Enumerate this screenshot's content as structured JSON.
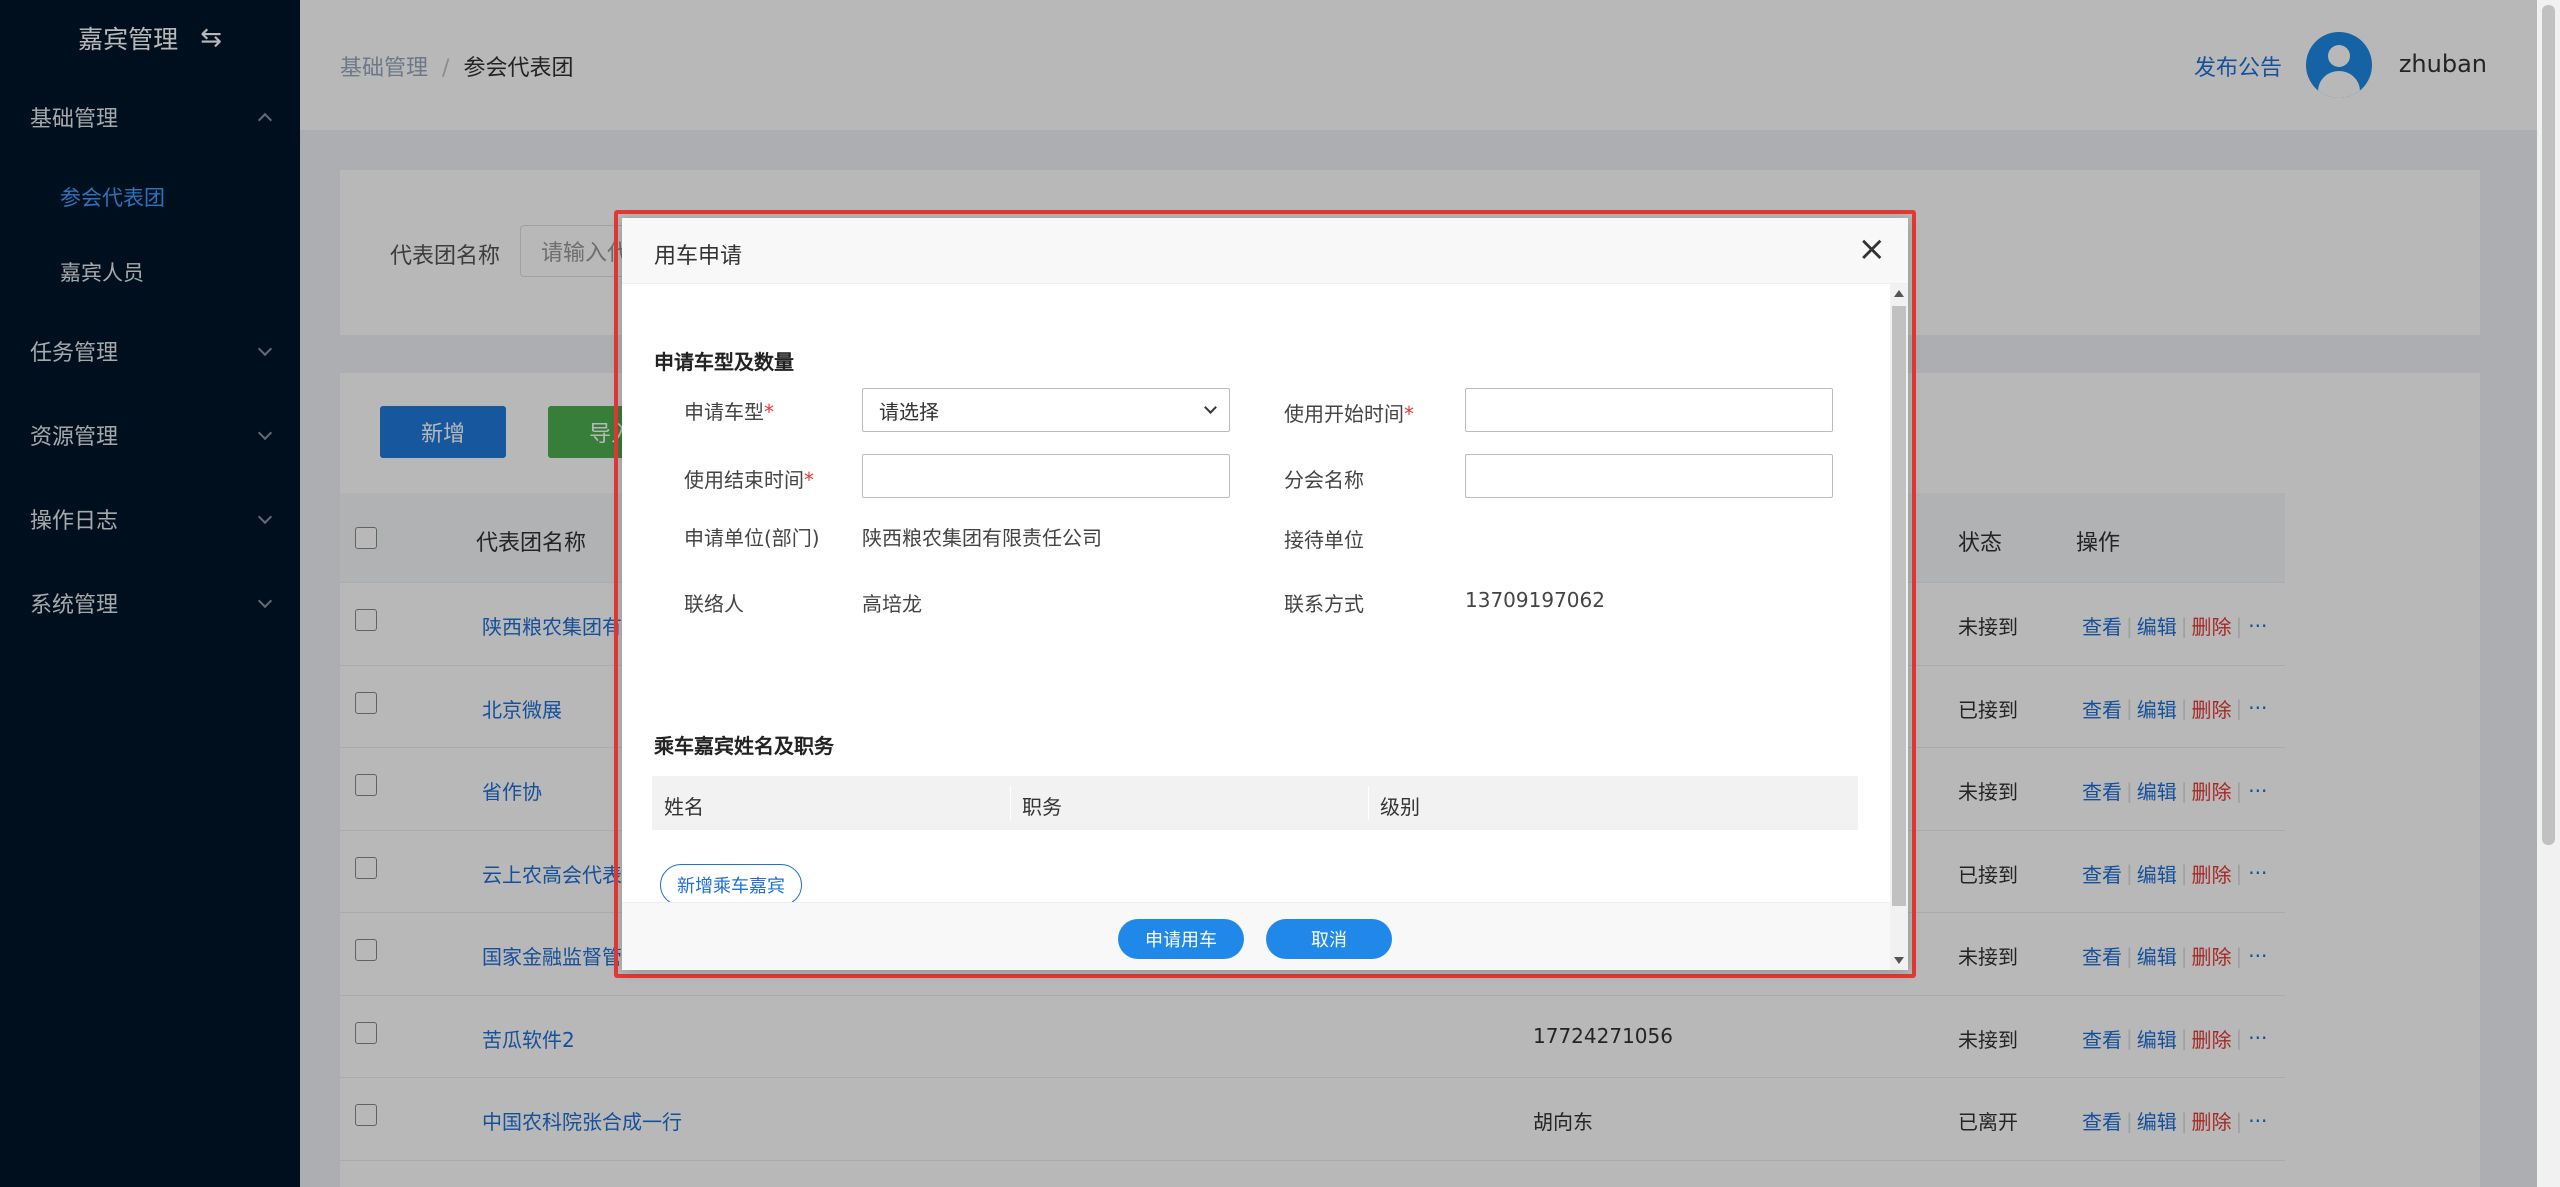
{
  "sidebar": {
    "title": "嘉宾管理",
    "groups": [
      {
        "label": "基础管理",
        "expanded": true,
        "items": [
          {
            "label": "参会代表团",
            "active": true
          },
          {
            "label": "嘉宾人员",
            "active": false
          }
        ]
      },
      {
        "label": "任务管理",
        "expanded": false
      },
      {
        "label": "资源管理",
        "expanded": false
      },
      {
        "label": "操作日志",
        "expanded": false
      },
      {
        "label": "系统管理",
        "expanded": false
      }
    ]
  },
  "header": {
    "breadcrumb": [
      "基础管理",
      "参会代表团"
    ],
    "publish_link": "发布公告",
    "username": "zhuban"
  },
  "search": {
    "label": "代表团名称",
    "placeholder": "请输入代"
  },
  "toolbar": {
    "add_label": "新增",
    "import_label": "导入"
  },
  "table": {
    "headers": {
      "name": "代表团名称",
      "status": "状态",
      "ops": "操作"
    },
    "rows": [
      {
        "name": "陕西粮农集团有",
        "contact": "",
        "status": "未接到"
      },
      {
        "name": "北京微展",
        "contact": "",
        "status": "已接到"
      },
      {
        "name": "省作协",
        "contact": "",
        "status": "未接到"
      },
      {
        "name": "云上农高会代表",
        "contact": "",
        "status": "已接到"
      },
      {
        "name": "国家金融监督管",
        "contact": "",
        "status": "未接到"
      },
      {
        "name": "苦瓜软件2",
        "contact": "17724271056",
        "status": "未接到"
      },
      {
        "name": "中国农科院张合成一行",
        "contact": "胡向东",
        "status": "已离开"
      }
    ],
    "ops": {
      "view": "查看",
      "edit": "编辑",
      "delete": "删除",
      "more": "···"
    }
  },
  "modal": {
    "title": "用车申请",
    "close_icon": "×",
    "section1_title": "申请车型及数量",
    "fields": {
      "car_type_label": "申请车型",
      "car_type_value": "请选择",
      "start_time_label": "使用开始时间",
      "end_time_label": "使用结束时间",
      "branch_label": "分会名称",
      "unit_label": "申请单位(部门)",
      "unit_value": "陕西粮农集团有限责任公司",
      "host_unit_label": "接待单位",
      "contact_label": "联络人",
      "contact_value": "高培龙",
      "phone_label": "联系方式",
      "phone_value": "13709197062",
      "required_mark": "*"
    },
    "section2_title": "乘车嘉宾姓名及职务",
    "guest_table_headers": [
      "姓名",
      "职务",
      "级别"
    ],
    "add_guest_label": "新增乘车嘉宾",
    "submit_label": "申请用车",
    "cancel_label": "取消"
  },
  "colors": {
    "sidebar_bg": "#001529",
    "primary": "#1f79db",
    "success": "#4caf50",
    "danger": "#e53935",
    "highlight_border": "#e53935"
  }
}
